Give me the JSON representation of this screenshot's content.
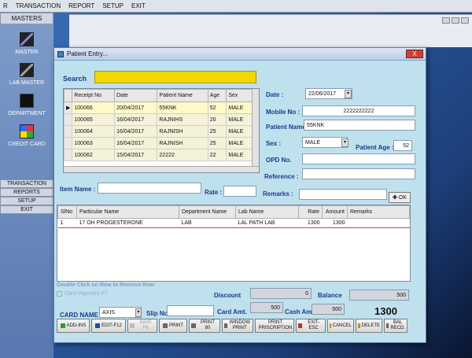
{
  "menubar": [
    "R",
    "TRANSACTION",
    "REPORT",
    "SETUP",
    "EXIT"
  ],
  "sidebar": {
    "masters_header": "MASTERS",
    "items": [
      {
        "label": "MASTER",
        "icon": "pen-icon"
      },
      {
        "label": "LAB MASTER",
        "icon": "syringe-icon"
      },
      {
        "label": "DEPARTMENT",
        "icon": "department-icon"
      },
      {
        "label": "CREDIT CARD",
        "icon": "grid-icon"
      }
    ],
    "buttons": [
      "TRANSACTION",
      "REPORTS",
      "SETUP",
      "EXIT"
    ]
  },
  "window": {
    "title": "Patient Entry...",
    "close": "X"
  },
  "search": {
    "label": "Search",
    "value": ""
  },
  "receipts": {
    "columns": [
      "Receipt No",
      "Date",
      "Patient Name",
      "Age",
      "Sex"
    ],
    "rows": [
      [
        "100066",
        "20/04/2017",
        "55KNK",
        "52",
        "MALE"
      ],
      [
        "100065",
        "16/04/2017",
        "RAJNIHS",
        "20",
        "MALE"
      ],
      [
        "100064",
        "16/04/2017",
        "RAJNISH",
        "25",
        "MALE"
      ],
      [
        "100063",
        "16/04/2017",
        "RAJNISH",
        "25",
        "MALE"
      ],
      [
        "100062",
        "15/04/2017",
        "22222",
        "22",
        "MALE"
      ]
    ]
  },
  "form": {
    "date_label": "Date :",
    "date": "22/06/2017",
    "mobile_label": "Mobile No :",
    "mobile": "2222222222",
    "patient_label": "Patient Name :",
    "patient": "55KNK",
    "sex_label": "Sex :",
    "sex": "MALE",
    "age_label": "Patient Age :",
    "age": "52",
    "opd_label": "OPD No.",
    "opd": "",
    "reference_label": "Reference :",
    "reference": ""
  },
  "item_row": {
    "item_label": "Item Name :",
    "item": "",
    "rate_label": "Rate :",
    "rate": "",
    "remarks_label": "Remarks :",
    "remarks": "",
    "ok_label": "OK"
  },
  "items": {
    "columns": [
      "SlNo",
      "Particular Name",
      "Department Name",
      "Lab Name",
      "Rate",
      "Amount",
      "Remarks"
    ],
    "rows": [
      [
        "1",
        "17 OH PROGESTERONE",
        "LAB",
        "LAL PATH LAB",
        "1300",
        "1300",
        ""
      ]
    ]
  },
  "footer": {
    "hint": "Double Click on Row to Remove Row",
    "card_payment": "Card Payment F7",
    "discount_label": "Discount",
    "discount": "0",
    "balance_label": "Balance",
    "balance": "500",
    "card_name_label": "CARD NAME",
    "card_name": "AXIS",
    "slip_label": "Slip No",
    "slip": "",
    "card_amt_label": "Card Amt.",
    "card_amt": "500",
    "cash_amt_label": "Cash Amt.",
    "cash_amt": "500",
    "total": "1300"
  },
  "toolbar": [
    {
      "label": "ADD-INS",
      "icon": "check-icon",
      "color": "#2a9d2a",
      "enabled": true
    },
    {
      "label": "EDIT-F12",
      "icon": "edit-icon",
      "color": "#1f4fa0",
      "enabled": true
    },
    {
      "label": "SAVE F6",
      "icon": "save-icon",
      "color": "#999999",
      "enabled": false
    },
    {
      "label": "PRINT",
      "icon": "printer-icon",
      "color": "#555555",
      "enabled": true
    },
    {
      "label": "PRINT 80",
      "icon": "printer-icon",
      "color": "#555555",
      "enabled": true
    },
    {
      "label": "WINDOW PRINT",
      "icon": "printer-icon",
      "color": "#555555",
      "enabled": true
    },
    {
      "label": "PRINT PRISCRIPTION",
      "icon": "printer-icon",
      "color": "#555555",
      "enabled": true
    },
    {
      "label": "EXIT-ESC",
      "icon": "close-icon",
      "color": "#c0302a",
      "enabled": true
    },
    {
      "label": "CANCEL",
      "icon": "folder-icon",
      "color": "#c09020",
      "enabled": true
    },
    {
      "label": "DELETE",
      "icon": "delete-icon",
      "color": "#c09020",
      "enabled": true
    },
    {
      "label": "BAL RECD.",
      "icon": "money-icon",
      "color": "#666666",
      "enabled": true
    }
  ],
  "colors": {
    "search_bar": "#f0d800",
    "window_bg": "#bfe1ee",
    "label": "#1a3a8a",
    "row_separator": "#d04040"
  }
}
